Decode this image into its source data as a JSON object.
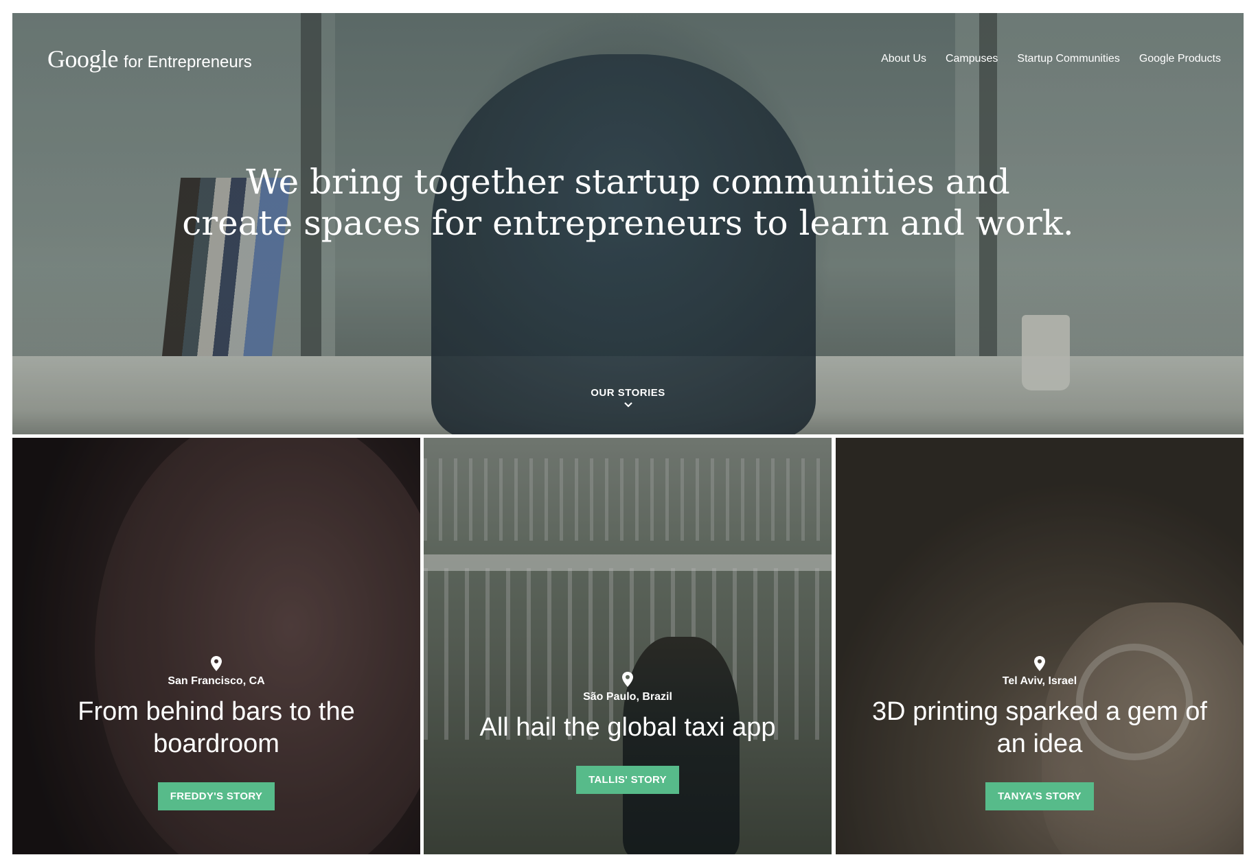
{
  "brand": {
    "logo": "Google",
    "suffix": "for Entrepreneurs"
  },
  "nav": {
    "items": [
      "About Us",
      "Campuses",
      "Startup Communities",
      "Google Products"
    ]
  },
  "hero": {
    "headline_line1": "We bring together startup communities and",
    "headline_line2": "create spaces for entrepreneurs to learn and work.",
    "cta": "OUR STORIES"
  },
  "stories": [
    {
      "location": "San Francisco, CA",
      "title": "From behind bars to the boardroom",
      "button": "FREDDY'S STORY"
    },
    {
      "location": "São Paulo, Brazil",
      "title": "All hail the global taxi app",
      "button": "TALLIS' STORY"
    },
    {
      "location": "Tel Aviv, Israel",
      "title": "3D printing sparked a gem of an idea",
      "button": "TANYA'S STORY"
    }
  ],
  "colors": {
    "button_green": "#57bb8a",
    "text": "#ffffff"
  },
  "icons": [
    "map-pin-icon",
    "chevron-down-icon"
  ]
}
